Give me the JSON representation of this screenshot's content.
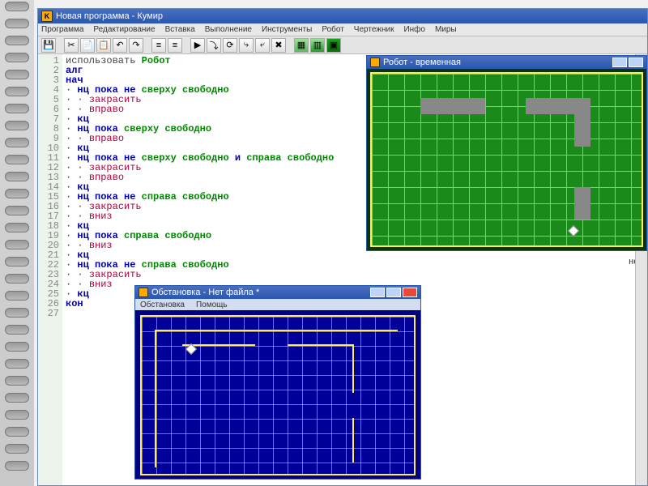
{
  "app": {
    "title": "Новая программа - Кумир",
    "menus": [
      "Программа",
      "Редактирование",
      "Вставка",
      "Выполнение",
      "Инструменты",
      "Робот",
      "Чертежник",
      "Инфо",
      "Миры"
    ]
  },
  "toolbar": {
    "save": "💾",
    "cut": "✂",
    "copy": "📄",
    "paste": "📋",
    "undo": "↶",
    "redo": "↷",
    "doc1": "≡",
    "doc2": "≡",
    "play": "▶",
    "step": "⤵",
    "over": "⟳",
    "into": "⤷",
    "out": "⤶",
    "stop": "✖",
    "grid1": "▦",
    "grid2": "▥",
    "grid3": "▣"
  },
  "code": {
    "lines": [
      {
        "n": "1",
        "t": "использовать ",
        "kw": "",
        "rb": "Робот"
      },
      {
        "n": "2",
        "t": "",
        "kw": "алг"
      },
      {
        "n": "3",
        "t": "",
        "kw": "нач"
      },
      {
        "n": "4",
        "t": "· ",
        "kw": "нц пока не ",
        "rb": "сверху свободно"
      },
      {
        "n": "5",
        "t": "· · ",
        "cmd": "закрасить"
      },
      {
        "n": "6",
        "t": "· · ",
        "cmd": "вправо"
      },
      {
        "n": "7",
        "t": "· ",
        "kw": "кц"
      },
      {
        "n": "8",
        "t": "· ",
        "kw": "нц пока ",
        "rb": "сверху свободно"
      },
      {
        "n": "9",
        "t": "· · ",
        "cmd": "вправо"
      },
      {
        "n": "10",
        "t": "· ",
        "kw": "кц"
      },
      {
        "n": "11",
        "t": "· ",
        "kw": "нц пока не ",
        "rb": "сверху свободно",
        "kw2": " и ",
        "rb2": "справа свободно"
      },
      {
        "n": "12",
        "t": "· · ",
        "cmd": "закрасить"
      },
      {
        "n": "13",
        "t": "· · ",
        "cmd": "вправо"
      },
      {
        "n": "14",
        "t": "· ",
        "kw": "кц"
      },
      {
        "n": "15",
        "t": "· ",
        "kw": "нц пока не ",
        "rb": "справа свободно"
      },
      {
        "n": "16",
        "t": "· · ",
        "cmd": "закрасить"
      },
      {
        "n": "17",
        "t": "· · ",
        "cmd": "вниз"
      },
      {
        "n": "18",
        "t": "· ",
        "kw": "кц"
      },
      {
        "n": "19",
        "t": "· ",
        "kw": "нц пока ",
        "rb": "справа свободно"
      },
      {
        "n": "20",
        "t": "· · ",
        "cmd": "вниз"
      },
      {
        "n": "21",
        "t": "· ",
        "kw": "кц"
      },
      {
        "n": "22",
        "t": "· ",
        "kw": "нц пока не ",
        "rb": "справа свободно"
      },
      {
        "n": "23",
        "t": "· · ",
        "cmd": "закрасить"
      },
      {
        "n": "24",
        "t": "· · ",
        "cmd": "вниз"
      },
      {
        "n": "25",
        "t": "· ",
        "kw": "кц"
      },
      {
        "n": "26",
        "t": "",
        "kw": "кон"
      },
      {
        "n": "27",
        "t": ""
      }
    ]
  },
  "robot": {
    "title": "Робот - временная"
  },
  "sit": {
    "title": "Обстановка - Нет файла *",
    "menus": [
      "Обстановка",
      "Помощь"
    ]
  },
  "rightText": "нет"
}
